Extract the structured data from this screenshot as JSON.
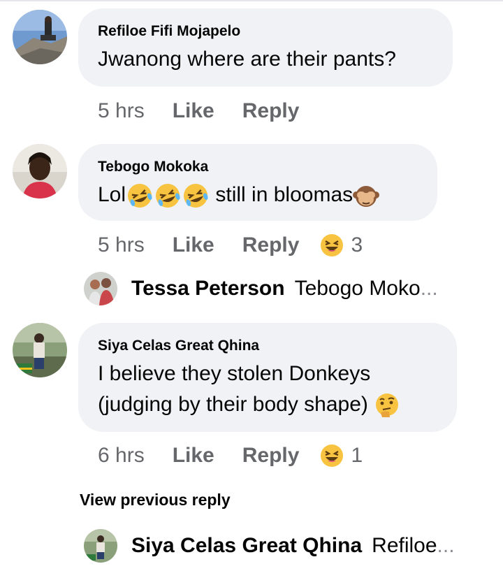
{
  "comments": [
    {
      "author": "Refiloe Fifi Mojapelo",
      "text": "Jwanong where are their pants?",
      "time": "5 hrs",
      "like": "Like",
      "reply": "Reply"
    },
    {
      "author": "Tebogo Mokoka",
      "text_prefix": "Lol",
      "text_suffix": "still in bloomas",
      "time": "5 hrs",
      "like": "Like",
      "reply": "Reply",
      "reaction_count": "3",
      "reaction_icon": "laughing-emoji-icon"
    },
    {
      "author": "Siya Celas Great Qhina",
      "text_line1": "I believe they stolen Donkeys",
      "text_line2": "(judging by their body shape)",
      "time": "6 hrs",
      "like": "Like",
      "reply": "Reply",
      "reaction_count": "1",
      "reaction_icon": "laughing-emoji-icon"
    }
  ],
  "replies": [
    {
      "author": "Tessa Peterson",
      "preview": "Tebogo Moko",
      "ellipsis": "..."
    },
    {
      "author": "Siya Celas Great Qhina",
      "preview": "Refiloe",
      "ellipsis": "..."
    }
  ],
  "view_previous": "View previous reply",
  "colors": {
    "bubble": "#f0f2f5",
    "meta": "#65676b",
    "text": "#050505"
  }
}
